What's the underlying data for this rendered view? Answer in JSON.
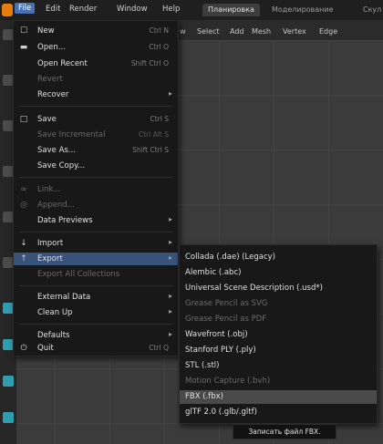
{
  "menubar": {
    "items": [
      "File",
      "Edit",
      "Render",
      "Window",
      "Help"
    ],
    "active": "File"
  },
  "workspaces": {
    "tabs": [
      "Планировка",
      "Моделирование",
      "Скул"
    ]
  },
  "header": {
    "items": [
      "w",
      "Select",
      "Add",
      "Mesh",
      "Vertex",
      "Edge"
    ]
  },
  "file_menu": {
    "items": [
      {
        "label": "New",
        "shortcut": "Ctrl N",
        "icon": "new-file-icon"
      },
      {
        "label": "Open...",
        "shortcut": "Ctrl O",
        "icon": "folder-icon"
      },
      {
        "label": "Open Recent",
        "shortcut": "Shift Ctrl O"
      },
      {
        "label": "Revert",
        "shortcut": ""
      },
      {
        "label": "Recover",
        "shortcut": ""
      },
      {
        "label": "Save",
        "shortcut": "Ctrl S",
        "icon": "save-icon"
      },
      {
        "label": "Save Incremental",
        "shortcut": "Ctrl Alt S"
      },
      {
        "label": "Save As...",
        "shortcut": "Shift Ctrl S"
      },
      {
        "label": "Save Copy...",
        "shortcut": ""
      },
      {
        "label": "Link...",
        "shortcut": "",
        "icon": "link-icon"
      },
      {
        "label": "Append...",
        "shortcut": "",
        "icon": "append-icon"
      },
      {
        "label": "Data Previews",
        "shortcut": ""
      },
      {
        "label": "Import",
        "shortcut": "",
        "icon": "import-icon"
      },
      {
        "label": "Export",
        "shortcut": "",
        "icon": "export-icon"
      },
      {
        "label": "Export All Collections",
        "shortcut": ""
      },
      {
        "label": "External Data",
        "shortcut": ""
      },
      {
        "label": "Clean Up",
        "shortcut": ""
      },
      {
        "label": "Defaults",
        "shortcut": ""
      },
      {
        "label": "Quit",
        "shortcut": "Ctrl Q",
        "icon": "power-icon"
      }
    ]
  },
  "export_submenu": {
    "items": [
      "Collada (.dae) (Legacy)",
      "Alembic (.abc)",
      "Universal Scene Description (.usd*)",
      "Grease Pencil as SVG",
      "Grease Pencil as PDF",
      "Wavefront (.obj)",
      "Stanford PLY (.ply)",
      "STL (.stl)",
      "Motion Capture (.bvh)",
      "FBX (.fbx)",
      "glTF 2.0 (.glb/.gltf)"
    ],
    "active": "FBX (.fbx)"
  },
  "tooltip": {
    "text": "Записать файл FBX."
  },
  "colors": {
    "menu_bg": "#181818",
    "highlight": "#38527a",
    "hover": "#4a4a4a",
    "accent": "#4772b3"
  }
}
